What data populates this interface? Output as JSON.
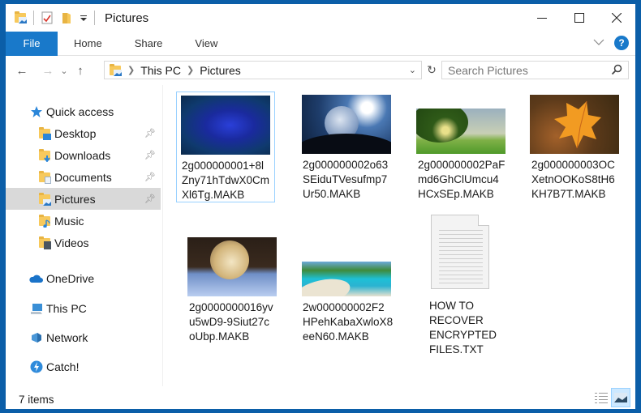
{
  "window": {
    "title": "Pictures",
    "controls": {
      "minimize": "—",
      "maximize": "☐",
      "close": "✕"
    }
  },
  "ribbon": {
    "tabs": [
      {
        "label": "File",
        "active": true
      },
      {
        "label": "Home"
      },
      {
        "label": "Share"
      },
      {
        "label": "View"
      }
    ],
    "expand_icon": "chevron-down",
    "help_label": "?"
  },
  "navigation": {
    "back": "←",
    "forward": "→",
    "recent": "⌄",
    "up": "↑",
    "breadcrumb": [
      "This PC",
      "Pictures"
    ],
    "refresh": "↻",
    "search_placeholder": "Search Pictures"
  },
  "sidebar": {
    "quick_access": "Quick access",
    "pinned": [
      {
        "label": "Desktop",
        "pinned": true
      },
      {
        "label": "Downloads",
        "pinned": true
      },
      {
        "label": "Documents",
        "pinned": true
      },
      {
        "label": "Pictures",
        "pinned": true,
        "selected": true
      },
      {
        "label": "Music",
        "pinned": false
      },
      {
        "label": "Videos",
        "pinned": false
      }
    ],
    "locations": [
      {
        "label": "OneDrive"
      },
      {
        "label": "This PC"
      },
      {
        "label": "Network"
      },
      {
        "label": "Catch!"
      }
    ]
  },
  "files": [
    {
      "name": "2g000000001+8lZny71hTdwX0CmXl6Tg.MAKB",
      "lines": [
        "2g000000001+8l",
        "Zny71hTdwX0Cm",
        "Xl6Tg.MAKB"
      ],
      "thumb": "blue-rose",
      "selected": true
    },
    {
      "name": "2g000000002o63SEiduTVesufmp7Ur50.MAKB",
      "lines": [
        "2g000000002o63",
        "SEiduTVesufmp7",
        "Ur50.MAKB"
      ],
      "thumb": "moon-bubble"
    },
    {
      "name": "2g000000002PaFmd6GhClUmcu4HCxSEp.MAKB",
      "lines": [
        "2g000000002PaF",
        "md6GhClUmcu4",
        "HCxSEp.MAKB"
      ],
      "thumb": "park-tree"
    },
    {
      "name": "2g000000003OCXetnOOKoS8tH6KH7B7T.MAKB",
      "lines": [
        "2g000000003OC",
        "XetnOOKoS8tH6",
        "KH7B7T.MAKB"
      ],
      "thumb": "autumn-leaf"
    },
    {
      "name": "2g0000000016yvu5wD9-9Siut27coUbp.MAKB",
      "lines": [
        "2g0000000016yv",
        "u5wD9-9Siut27c",
        "oUbp.MAKB"
      ],
      "thumb": "frozen-bubble"
    },
    {
      "name": "2w000000002F2HPehKabaXwloX8eeN60.MAKB",
      "lines": [
        "2w000000002F2",
        "HPehKabaXwloX8",
        "eeN60.MAKB"
      ],
      "thumb": "beach"
    },
    {
      "name": "HOW TO RECOVER ENCRYPTED FILES.TXT",
      "lines": [
        "HOW TO",
        "RECOVER",
        "ENCRYPTED",
        "FILES.TXT"
      ],
      "thumb": "text-document"
    }
  ],
  "status": {
    "item_count": "7 items"
  },
  "colors": {
    "accent": "#1979ca",
    "frame": "#0b5ea8",
    "selection": "#cce8ff",
    "nav_selected": "#d9d9d9"
  }
}
